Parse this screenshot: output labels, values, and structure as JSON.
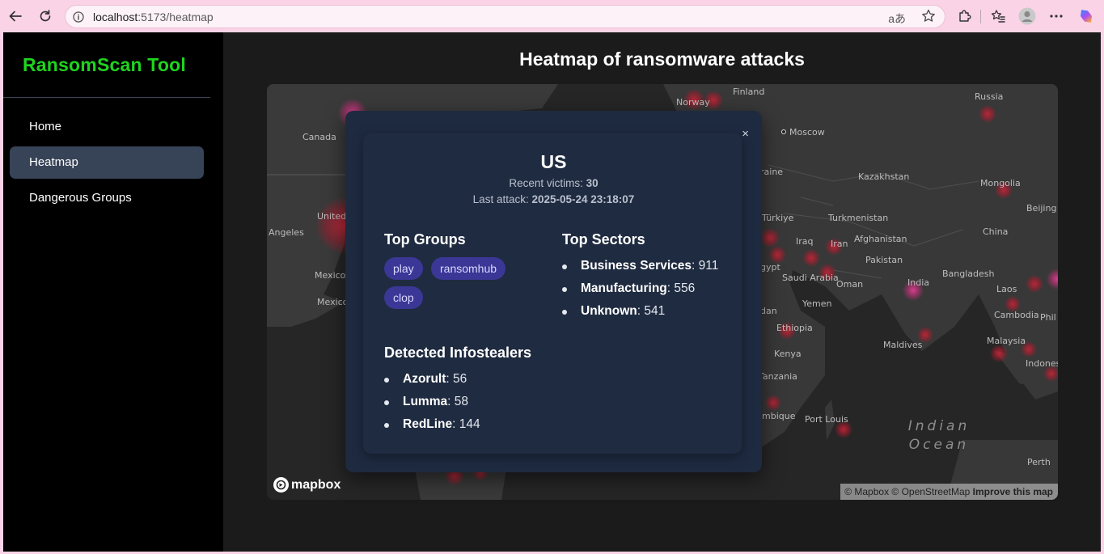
{
  "browser": {
    "url_host": "localhost",
    "url_port_path": ":5173/heatmap",
    "translate_icon": "aあ",
    "icons": [
      "back-arrow-icon",
      "reload-icon",
      "info-icon",
      "translate-icon",
      "star-icon",
      "extensions-icon",
      "favorites-icon",
      "profile-icon",
      "more-icon",
      "copilot-icon"
    ]
  },
  "sidebar": {
    "brand": "RansomScan Tool",
    "items": [
      {
        "label": "Home",
        "active": false
      },
      {
        "label": "Heatmap",
        "active": true
      },
      {
        "label": "Dangerous Groups",
        "active": false
      }
    ]
  },
  "main": {
    "title": "Heatmap of ransomware attacks"
  },
  "map": {
    "labels": [
      "Canada",
      "Norway",
      "Finland",
      "Russia",
      "Moscow",
      "Kazakhstan",
      "Mongolia",
      "Beijing",
      "Türkiye",
      "Turkmenistan",
      "Afghanistan",
      "China",
      "Iraq",
      "Iran",
      "Pakistan",
      "Saudi Arabia",
      "Oman",
      "India",
      "Bangladesh",
      "Laos",
      "Yemen",
      "Cambodia",
      "Ethiopia",
      "Maldives",
      "Malaysia",
      "Kenya",
      "Tanzania",
      "Indonesia",
      "Port Louis",
      "Perth",
      "Angeles",
      "United",
      "Mexico",
      "Mexico",
      "raine",
      "gypt",
      "dan",
      "Phil",
      "mbique"
    ],
    "ocean": "Indian\nOcean",
    "logo": "mapbox",
    "attribution": "© Mapbox © OpenStreetMap",
    "improve": "Improve this map"
  },
  "popup": {
    "close": "×",
    "country": "US",
    "recent_victims_label": "Recent victims: ",
    "recent_victims": "30",
    "last_attack_label": "Last attack: ",
    "last_attack": "2025-05-24 23:18:07",
    "top_groups_title": "Top Groups",
    "groups": [
      "play",
      "ransomhub",
      "clop"
    ],
    "top_sectors_title": "Top Sectors",
    "sectors": [
      {
        "name": "Business Services",
        "count": ": 911"
      },
      {
        "name": "Manufacturing",
        "count": ": 556"
      },
      {
        "name": "Unknown",
        "count": ": 541"
      }
    ],
    "infostealers_title": "Detected Infostealers",
    "infostealers": [
      {
        "name": "Azorult",
        "count": ": 56"
      },
      {
        "name": "Lumma",
        "count": ": 58"
      },
      {
        "name": "RedLine",
        "count": ": 144"
      }
    ]
  },
  "colors": {
    "brand_green": "#1ed51e",
    "active_nav": "#374357",
    "popup_bg": "#1e2a40",
    "chip_bg": "#3b3796",
    "hotspot": "#cd2337"
  }
}
